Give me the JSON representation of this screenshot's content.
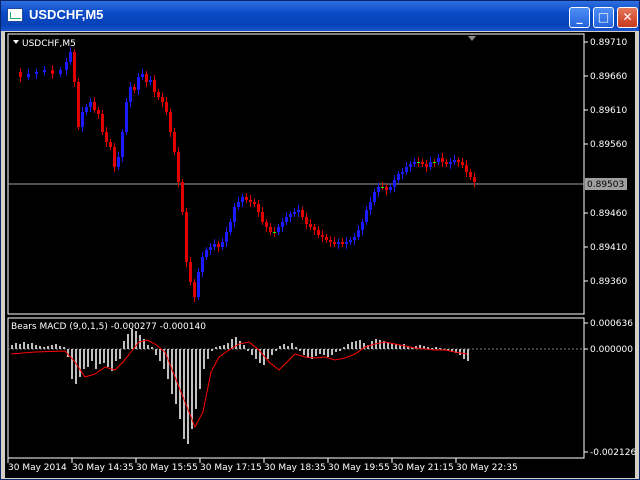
{
  "window": {
    "title": "USDCHF,M5",
    "minimize_icon": "minimize-icon",
    "maximize_icon": "maximize-icon",
    "close_icon": "close-icon"
  },
  "main_chart": {
    "label": "USDCHF,M5",
    "price_levels": [
      "0.89710",
      "0.89660",
      "0.89610",
      "0.89560",
      "0.89460",
      "0.89410",
      "0.89360"
    ],
    "current_price": "0.89503"
  },
  "indicator": {
    "label": "Bears MACD (9,0,1,5) -0.000277 -0.000140",
    "levels": [
      "0.000636",
      "0.000000",
      "-0.002126"
    ]
  },
  "time_axis": [
    "30 May 2014",
    "30 May 14:35",
    "30 May 15:55",
    "30 May 17:15",
    "30 May 18:35",
    "30 May 19:55",
    "30 May 21:15",
    "30 May 22:35"
  ],
  "colors": {
    "up": "#1a1aff",
    "down": "#e00000",
    "doji": "#00ff00",
    "grid": "#ffffff",
    "signal": "#ff0000",
    "histogram": "#c0c0c0"
  }
}
